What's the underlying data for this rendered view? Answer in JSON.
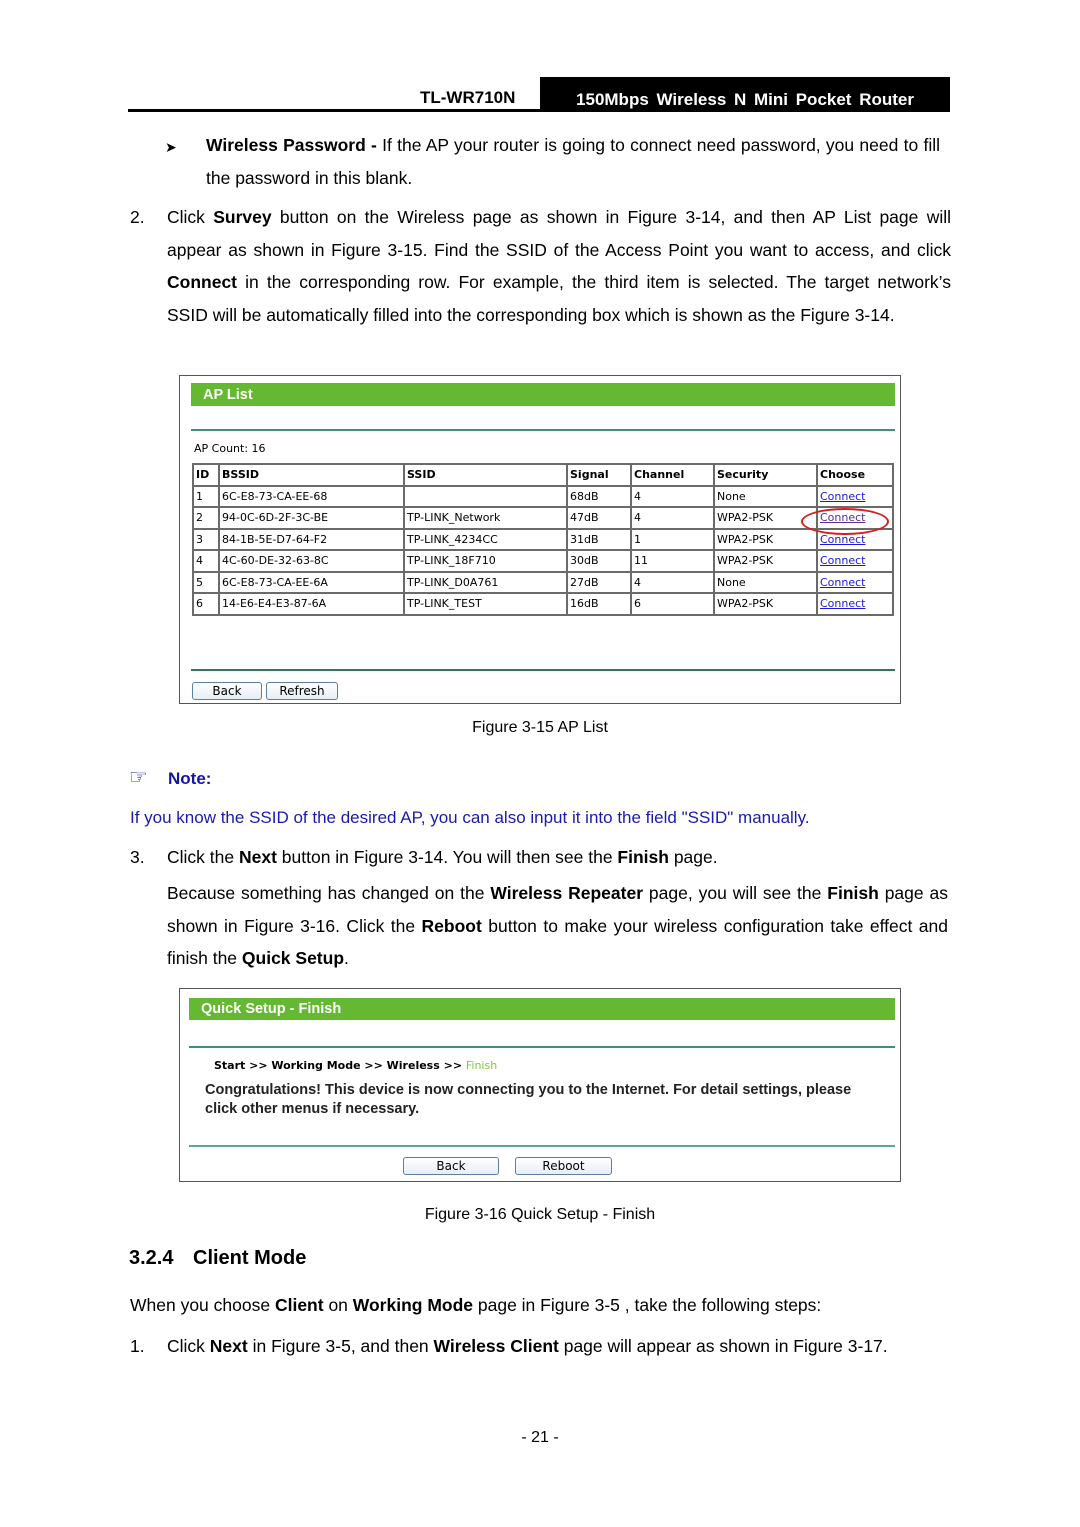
{
  "header": {
    "model": "TL-WR710N",
    "product": "150Mbps Wireless N Mini Pocket Router"
  },
  "bullet_wireless_password": {
    "label": "Wireless Password -",
    "text": " If the AP your router is going to connect need password, you need to fill the password in this blank."
  },
  "step2": {
    "number": "2.",
    "parts": [
      "Click ",
      "Survey",
      " button on the Wireless page as shown in Figure 3-14, and then AP List page will appear as shown in Figure 3-15. Find the SSID of the Access Point you want to access, and click ",
      "Connect",
      " in the corresponding row. For example, the third item is selected. The target network’s SSID will be automatically filled into the corresponding box which is shown as the Figure 3-14."
    ]
  },
  "ap_list": {
    "title": "AP List",
    "count_label": "AP Count: 16",
    "columns": [
      "ID",
      "BSSID",
      "SSID",
      "Signal",
      "Channel",
      "Security",
      "Choose"
    ],
    "rows": [
      {
        "id": "1",
        "bssid": "6C-E8-73-CA-EE-68",
        "ssid": "",
        "signal": "68dB",
        "channel": "4",
        "security": "None",
        "choose": "Connect"
      },
      {
        "id": "2",
        "bssid": "94-0C-6D-2F-3C-BE",
        "ssid": "TP-LINK_Network",
        "signal": "47dB",
        "channel": "4",
        "security": "WPA2-PSK",
        "choose": "Connect"
      },
      {
        "id": "3",
        "bssid": "84-1B-5E-D7-64-F2",
        "ssid": "TP-LINK_4234CC",
        "signal": "31dB",
        "channel": "1",
        "security": "WPA2-PSK",
        "choose": "Connect"
      },
      {
        "id": "4",
        "bssid": "4C-60-DE-32-63-8C",
        "ssid": "TP-LINK_18F710",
        "signal": "30dB",
        "channel": "11",
        "security": "WPA2-PSK",
        "choose": "Connect"
      },
      {
        "id": "5",
        "bssid": "6C-E8-73-CA-EE-6A",
        "ssid": "TP-LINK_D0A761",
        "signal": "27dB",
        "channel": "4",
        "security": "None",
        "choose": "Connect"
      },
      {
        "id": "6",
        "bssid": "14-E6-E4-E3-87-6A",
        "ssid": "TP-LINK_TEST",
        "signal": "16dB",
        "channel": "6",
        "security": "WPA2-PSK",
        "choose": "Connect"
      }
    ],
    "back_label": "Back",
    "refresh_label": "Refresh",
    "caption": "Figure 3-15 AP List"
  },
  "note": {
    "title": "Note:",
    "text": "If you know the SSID of the desired AP, you can also input it into the field \"SSID\" manually."
  },
  "step3": {
    "number": "3.",
    "parts": [
      "Click the ",
      "Next",
      " button in Figure 3-14. You will then see the ",
      "Finish",
      " page."
    ],
    "para2": [
      "Because something has changed on the ",
      "Wireless Repeater",
      " page, you will see the ",
      "Finish",
      " page as shown in Figure 3-16. Click the ",
      "Reboot",
      " button to make your wireless configuration take effect and finish the ",
      "Quick Setup",
      "."
    ]
  },
  "quick_setup": {
    "title": "Quick Setup - Finish",
    "breadcrumb": [
      "Start >> Working Mode >> Wireless >> ",
      "Finish"
    ],
    "message": "Congratulations! This device is now connecting you to the Internet. For detail settings, please click other menus if necessary.",
    "back_label": "Back",
    "reboot_label": "Reboot",
    "caption": "Figure 3-16 Quick Setup - Finish"
  },
  "section": {
    "number": "3.2.4",
    "title": "Client Mode"
  },
  "client_intro": [
    "When you choose ",
    "Client",
    " on ",
    "Working Mode",
    " page in Figure 3-5 , take the following steps:"
  ],
  "client_step1": {
    "number": "1.",
    "parts": [
      "Click ",
      "Next",
      " in Figure 3-5, and then ",
      "Wireless Client",
      " page will appear as shown in Figure 3-17."
    ]
  },
  "page_number": "- 21 -",
  "colors": {
    "green_bar": "#65b832",
    "note_blue": "#1a1ab0",
    "link_blue": "#1a1adb",
    "highlight_red": "#d42020",
    "breadcrumb_active": "#7cc940"
  }
}
